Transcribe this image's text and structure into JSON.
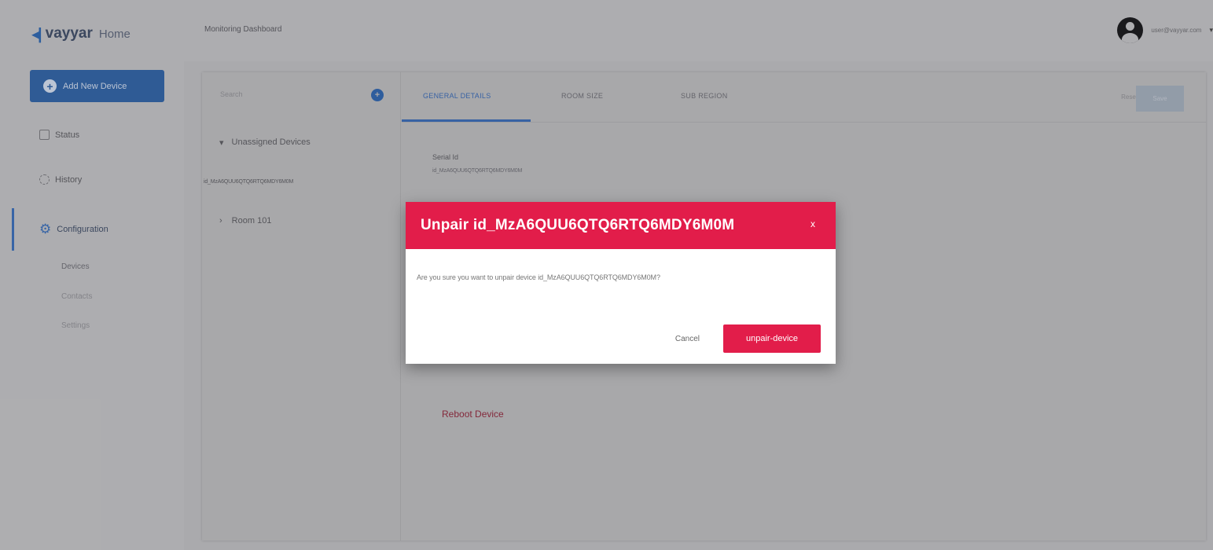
{
  "app": {
    "logo_brand": "vayyar",
    "logo_product": "Home",
    "page_title": "Monitoring Dashboard"
  },
  "user": {
    "email": "user@vayyar.com"
  },
  "sidebar": {
    "add_button_label": "Add New Device",
    "items": [
      {
        "label": "Status",
        "icon": "status-icon"
      },
      {
        "label": "History",
        "icon": "history-icon"
      },
      {
        "label": "Configuration",
        "icon": "gear-icon"
      }
    ],
    "sub_items": [
      {
        "label": "Devices"
      },
      {
        "label": "Contacts"
      },
      {
        "label": "Settings"
      }
    ]
  },
  "device_tree": {
    "search_placeholder": "Search",
    "group_label": "Unassigned Devices",
    "device_id": "id_MzA6QUU6QTQ6RTQ6MDY6M0M",
    "room_label": "Room 101"
  },
  "tabs": [
    {
      "label": "GENERAL DETAILS"
    },
    {
      "label": "ROOM SIZE"
    },
    {
      "label": "SUB REGION"
    }
  ],
  "actions": {
    "reset_label": "Reset",
    "save_label": "Save"
  },
  "details": {
    "serial_label": "Serial Id",
    "serial_value": "id_MzA6QUU6QTQ6RTQ6MDY6M0M",
    "reboot_label": "Reboot Device"
  },
  "dialog": {
    "title": "Unpair id_MzA6QUU6QTQ6RTQ6MDY6M0M",
    "close_label": "x",
    "message": "Are you sure you want to unpair device id_MzA6QUU6QTQ6RTQ6MDY6M0M?",
    "cancel_label": "Cancel",
    "confirm_label": "unpair-device"
  },
  "colors": {
    "accent": "#e21d4a",
    "primary": "#3a68ad"
  }
}
